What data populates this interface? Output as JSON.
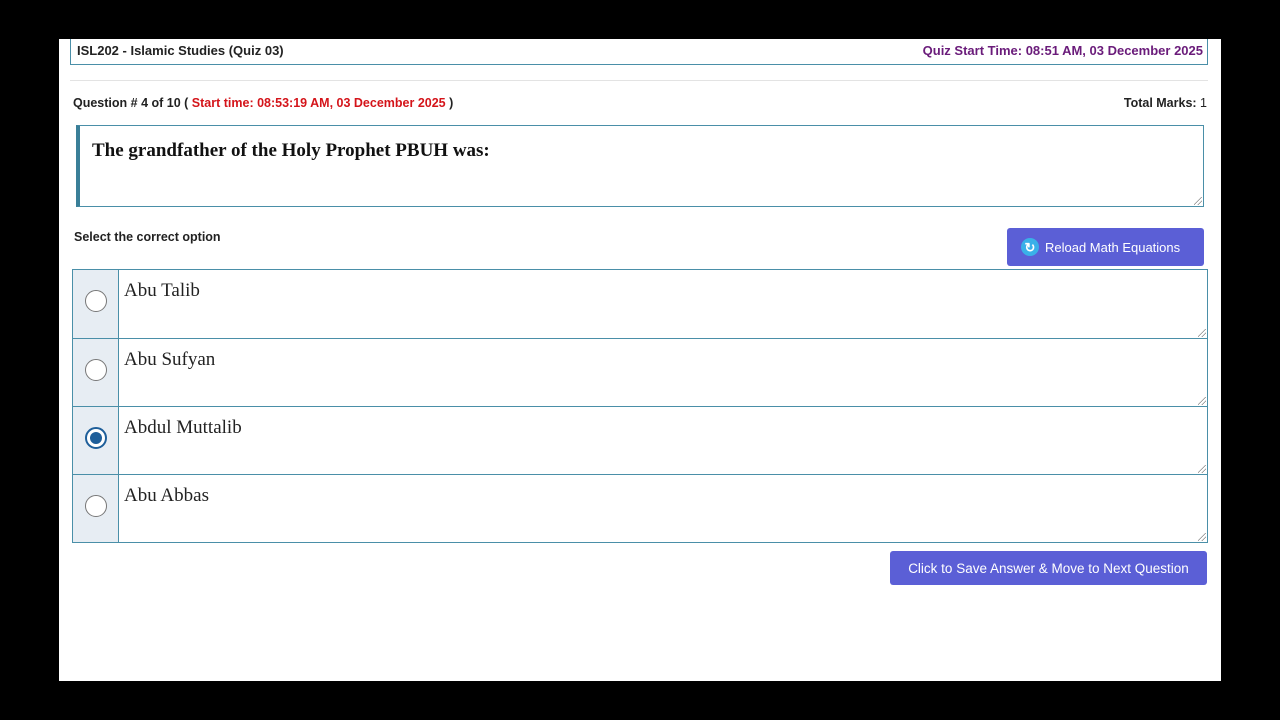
{
  "header": {
    "course_title": "ISL202 - Islamic Studies (Quiz 03)",
    "quiz_start": "Quiz Start Time: 08:51 AM, 03 December 2025"
  },
  "question": {
    "number_label": "Question # 4 of 10",
    "start_time": "Start time: 08:53:19 AM, 03 December 2025",
    "total_marks_label": "Total Marks:",
    "total_marks_value": "1",
    "text": "The grandfather of the Holy Prophet PBUH was:"
  },
  "select_label": "Select the correct option",
  "reload_button": {
    "label": "Reload Math Equations",
    "icon": "refresh-icon"
  },
  "options": [
    {
      "text": "Abu Talib",
      "selected": false
    },
    {
      "text": "Abu Sufyan",
      "selected": false
    },
    {
      "text": "Abdul Muttalib",
      "selected": true
    },
    {
      "text": "Abu Abbas",
      "selected": false
    }
  ],
  "next_button": {
    "label": "Click to Save Answer & Move to Next Question"
  },
  "colors": {
    "accent": "#5b5fd6",
    "border": "#4a8fa8",
    "start_time": "#d4141a",
    "quiz_start": "#6a1b7a",
    "radio_selected": "#1f5f9a"
  }
}
